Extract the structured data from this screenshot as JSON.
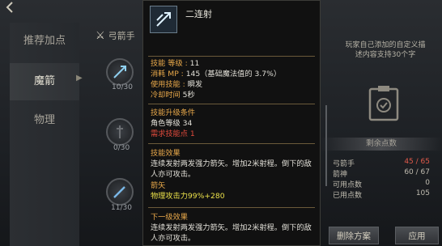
{
  "tabs": [
    {
      "label": "推荐加点",
      "selected": false
    },
    {
      "label": "魔箭",
      "selected": true
    },
    {
      "label": "物理",
      "selected": false
    }
  ],
  "tree": {
    "class_label": "弓箭手",
    "counts": [
      "10/30",
      "0/30",
      "11/30"
    ]
  },
  "tooltip": {
    "title": "二连射",
    "level_label": "技能 等级 : ",
    "level_value": "11",
    "mp_label": "消耗 MP : ",
    "mp_value": "145（基础魔法值的 3.7%）",
    "use_label": "使用技能 : ",
    "use_value": "瞬发",
    "cooldown_label": "冷却时间 ",
    "cooldown_value": "5秒",
    "upgrade_header": "技能升级条件",
    "char_level": "角色等级 34",
    "need_points": "需求技能点 1",
    "effect_header": "技能效果",
    "effect_line1": "连续发射两发强力箭矢。增加2米射程。倒下的敌",
    "effect_line2": "人亦可攻击。",
    "arrow_label": "箭矢",
    "arrow_value": "物理攻击力99%+280",
    "next_header": "下一级效果",
    "next_line1": "连续发射两发强力箭矢。增加2米射程。倒下的敌",
    "next_line2": "人亦可攻击。"
  },
  "right": {
    "custom_line1": "玩家自己添加的自定义描",
    "custom_line2": "述内容支持30个字",
    "remain_label": "剩余点数",
    "stats": [
      {
        "label": "弓箭手",
        "value": "45 / 65",
        "color": "#e25a4a"
      },
      {
        "label": "箭神",
        "value": "60 / 67",
        "color": "#c0bcb0"
      },
      {
        "label": "可用点数",
        "value": "0",
        "color": "#c0bcb0"
      },
      {
        "label": "已用点数",
        "value": "105",
        "color": "#c0bcb0"
      }
    ],
    "delete_button": "删除方案",
    "apply_button": "应用"
  }
}
